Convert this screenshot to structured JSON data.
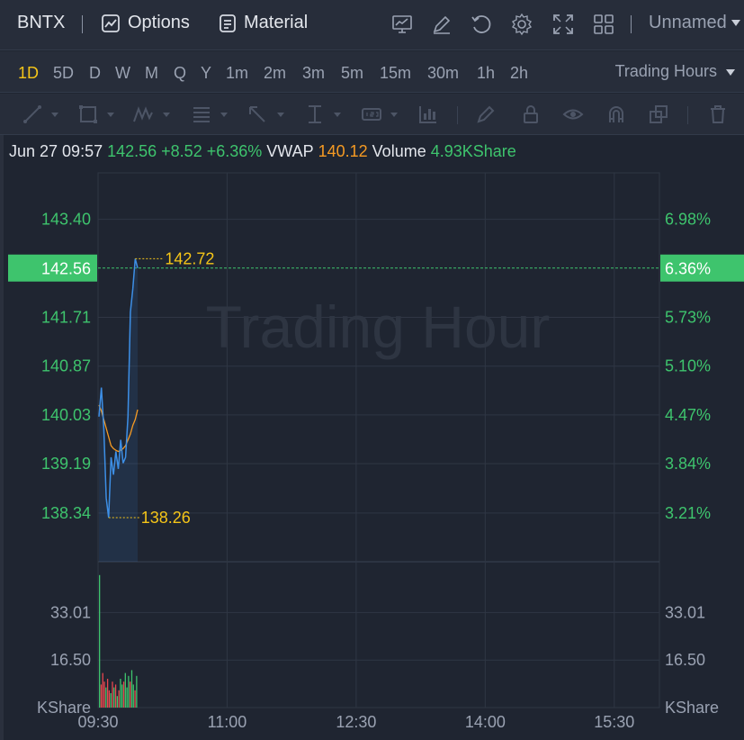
{
  "header": {
    "symbol": "BNTX",
    "options_label": "Options",
    "material_label": "Material",
    "layout_name": "Unnamed",
    "icons": [
      "chart-type-icon",
      "edit-icon",
      "refresh-icon",
      "gear-icon",
      "fullscreen-icon",
      "grid-layout-icon"
    ]
  },
  "periods": [
    "1D",
    "5D",
    "D",
    "W",
    "M",
    "Q",
    "Y",
    "1m",
    "2m",
    "3m",
    "5m",
    "15m",
    "30m",
    "1h",
    "2h"
  ],
  "active_period": "1D",
  "trading_hours_label": "Trading Hours",
  "drawing_tools": [
    "line-tool-icon",
    "rectangle-tool-icon",
    "pattern-tool-icon",
    "fib-tool-icon",
    "arrow-tool-icon",
    "measure-tool-icon",
    "price-label-tool-icon",
    "indicator-tool-icon",
    "brush-icon",
    "lock-icon",
    "eye-icon",
    "magnet-icon",
    "layers-icon",
    "trash-icon"
  ],
  "info": {
    "datetime": "Jun 27 09:57",
    "price": "142.56",
    "change": "+8.52",
    "change_pct": "+6.36%",
    "vwap_label": "VWAP",
    "vwap": "140.12",
    "volume_label": "Volume",
    "volume": "4.93KShare"
  },
  "colors": {
    "up": "#3ec46d",
    "down": "#e8474f",
    "price_line": "#3d8fe6",
    "vwap_line": "#f59a23",
    "highlight": "#f5c518",
    "background": "#1f2531"
  },
  "chart_data": {
    "type": "line",
    "watermark": "Trading Hour",
    "current_price": 142.56,
    "current_pct": "6.36%",
    "high_label": "142.72",
    "low_label": "138.26",
    "price_ticks": [
      "143.40",
      "141.71",
      "140.87",
      "140.03",
      "139.19",
      "138.34"
    ],
    "pct_ticks": [
      "6.98%",
      "5.73%",
      "5.10%",
      "4.47%",
      "3.84%",
      "3.21%"
    ],
    "ylim": [
      137.5,
      144.2
    ],
    "volume_ticks": [
      "33.01",
      "16.50"
    ],
    "volume_unit": "KShare",
    "volume_ylim": [
      0,
      50
    ],
    "x_ticks": [
      "09:30",
      "11:00",
      "12:30",
      "14:00",
      "15:30"
    ],
    "series": [
      {
        "values": [
          140.0,
          140.5,
          139.8,
          138.6,
          138.26,
          139.3,
          139.0,
          139.4,
          139.1,
          139.6,
          139.2,
          139.3,
          140.0,
          141.8,
          142.2,
          142.72,
          142.56
        ]
      },
      {
        "values": [
          140.2,
          140.1,
          139.95,
          139.8,
          139.65,
          139.5,
          139.45,
          139.42,
          139.4,
          139.42,
          139.45,
          139.5,
          139.6,
          139.7,
          139.85,
          139.95,
          140.12
        ]
      }
    ],
    "volume": {
      "values": [
        46,
        8,
        12,
        9,
        7,
        10,
        6,
        5,
        9,
        7,
        8,
        4,
        6,
        10,
        8,
        9,
        12,
        7,
        11,
        9,
        13,
        8,
        6,
        11
      ],
      "directions": [
        "up",
        "down",
        "down",
        "down",
        "up",
        "down",
        "down",
        "up",
        "down",
        "up",
        "down",
        "up",
        "down",
        "up",
        "up",
        "down",
        "up",
        "up",
        "up",
        "down",
        "up",
        "up",
        "down",
        "up"
      ]
    }
  }
}
